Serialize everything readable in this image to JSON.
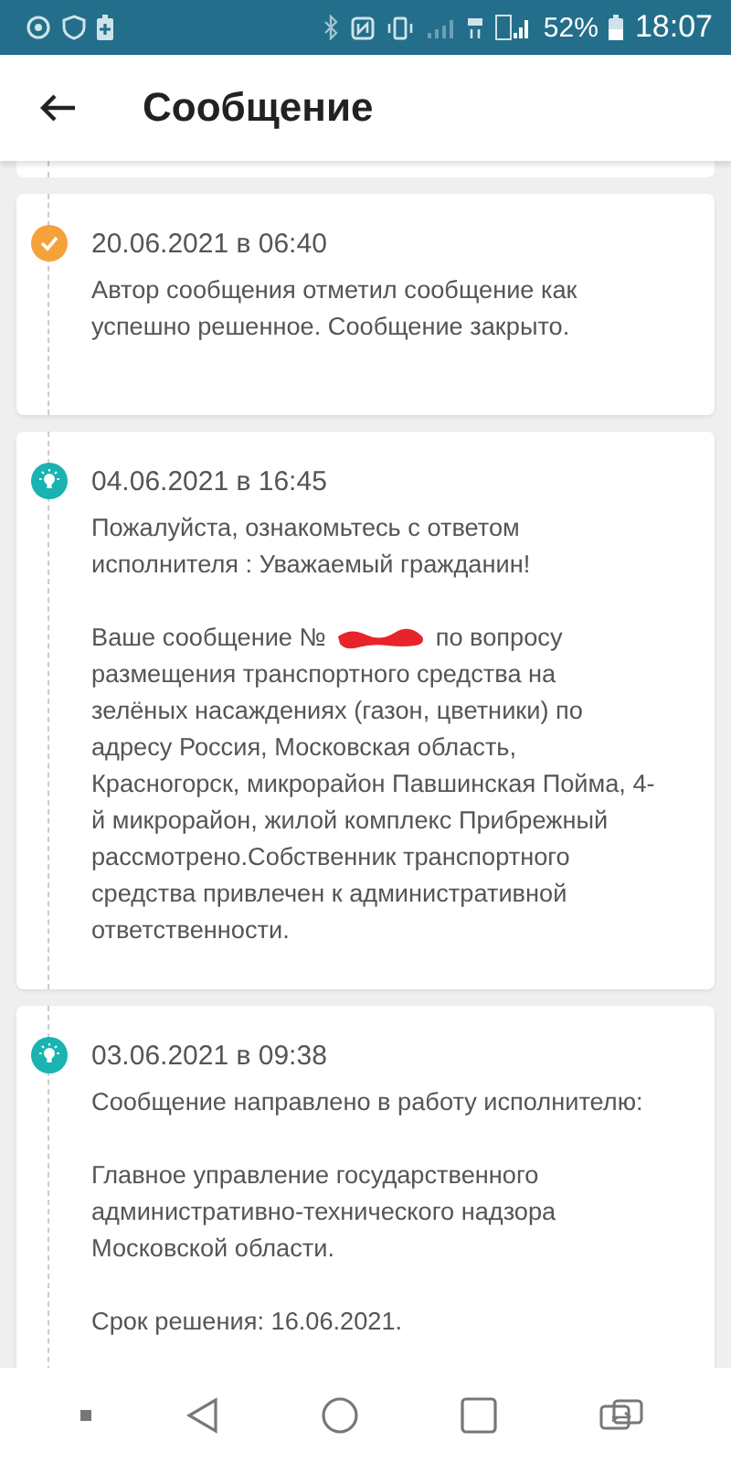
{
  "status_bar": {
    "battery": "52%",
    "time": "18:07"
  },
  "header": {
    "title": "Сообщение"
  },
  "events": [
    {
      "kind": "closed",
      "date": "20.06.2021 в 06:40",
      "paragraphs": [
        {
          "kind": "text",
          "text": "Автор сообщения отметил сообщение как успешно решенное. Сообщение закрыто."
        }
      ]
    },
    {
      "kind": "info",
      "date": "04.06.2021 в 16:45",
      "paragraphs": [
        {
          "kind": "text",
          "text": "Пожалуйста, ознакомьтесь с ответом исполнителя : Уважаемый гражданин!"
        },
        {
          "kind": "redacted",
          "before": "Ваше сообщение №",
          "after": "по вопросу",
          "rest": "размещения транспортного средства на зелёных насаждениях (газон, цветники) по адресу Россия, Московская область, Красногорск, микрорайон Павшинская Пойма, 4-й микрорайон, жилой комплекс Прибрежный рассмотрено.Собственник транспортного средства привлечен к административной ответственности."
        }
      ]
    },
    {
      "kind": "info",
      "date": "03.06.2021 в 09:38",
      "paragraphs": [
        {
          "kind": "text",
          "text": "Сообщение направлено в работу исполнителю:"
        },
        {
          "kind": "text",
          "text": "Главное управление государственного административно-технического надзора Московской области."
        },
        {
          "kind": "text",
          "text": "Срок решения: 16.06.2021."
        }
      ]
    }
  ]
}
